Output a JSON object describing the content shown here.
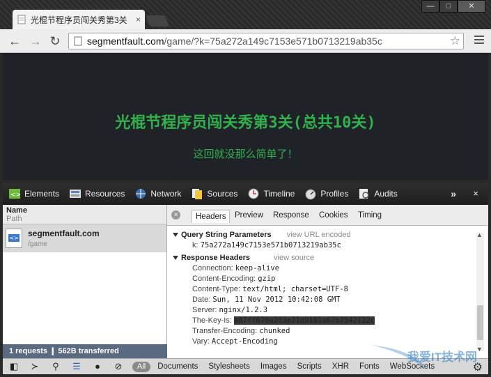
{
  "window": {
    "tab_title": "光棍节程序员闯关秀第3关",
    "tab_close": "×",
    "controls": {
      "minimize": "—",
      "maximize": "□",
      "close": "✕"
    }
  },
  "toolbar": {
    "url_host": "segmentfault.com",
    "url_path": "/game/?k=75a272a149c7153e571b0713219ab35c",
    "back": "←",
    "forward": "→",
    "reload": "↻",
    "star": "☆"
  },
  "page": {
    "title": "光棍节程序员闯关秀第3关(总共10关)",
    "subtitle": "这回就没那么简单了！",
    "text_color": "#33b04e"
  },
  "devtools": {
    "panels": [
      {
        "label": "Elements",
        "icon": "elements-icon"
      },
      {
        "label": "Resources",
        "icon": "resources-icon"
      },
      {
        "label": "Network",
        "icon": "network-icon"
      },
      {
        "label": "Sources",
        "icon": "sources-icon"
      },
      {
        "label": "Timeline",
        "icon": "timeline-icon"
      },
      {
        "label": "Profiles",
        "icon": "profiles-icon"
      },
      {
        "label": "Audits",
        "icon": "audits-icon"
      }
    ],
    "more": "»",
    "close": "×",
    "request_list": {
      "header_name": "Name",
      "header_path": "Path",
      "item_name": "segmentfault.com",
      "item_path": "/game",
      "status": "1 requests  ❙  562B transferred"
    },
    "detail_tabs": [
      "Headers",
      "Preview",
      "Response",
      "Cookies",
      "Timing"
    ],
    "query_section": {
      "title": "Query String Parameters",
      "link": "view URL encoded",
      "params": [
        {
          "key": "k:",
          "value": "75a272a149c7153e571b0713219ab35c"
        }
      ]
    },
    "response_section": {
      "title": "Response Headers",
      "link": "view source",
      "headers": [
        {
          "key": "Connection:",
          "value": "keep-alive"
        },
        {
          "key": "Content-Encoding:",
          "value": "gzip"
        },
        {
          "key": "Content-Type:",
          "value": "text/html; charset=UTF-8"
        },
        {
          "key": "Date:",
          "value": "Sun, 11 Nov 2012 10:42:08 GMT"
        },
        {
          "key": "Server:",
          "value": "nginx/1.2.3"
        },
        {
          "key": "The-Key-Is:",
          "value": "a87ff679a2f3e71d9181a67b7542122c"
        },
        {
          "key": "Transfer-Encoding:",
          "value": "chunked"
        },
        {
          "key": "Vary:",
          "value": "Accept-Encoding"
        }
      ]
    },
    "bottom_filters": [
      "All",
      "Documents",
      "Stylesheets",
      "Images",
      "Scripts",
      "XHR",
      "Fonts",
      "WebSockets"
    ]
  },
  "watermark": "我爱IT技术网"
}
